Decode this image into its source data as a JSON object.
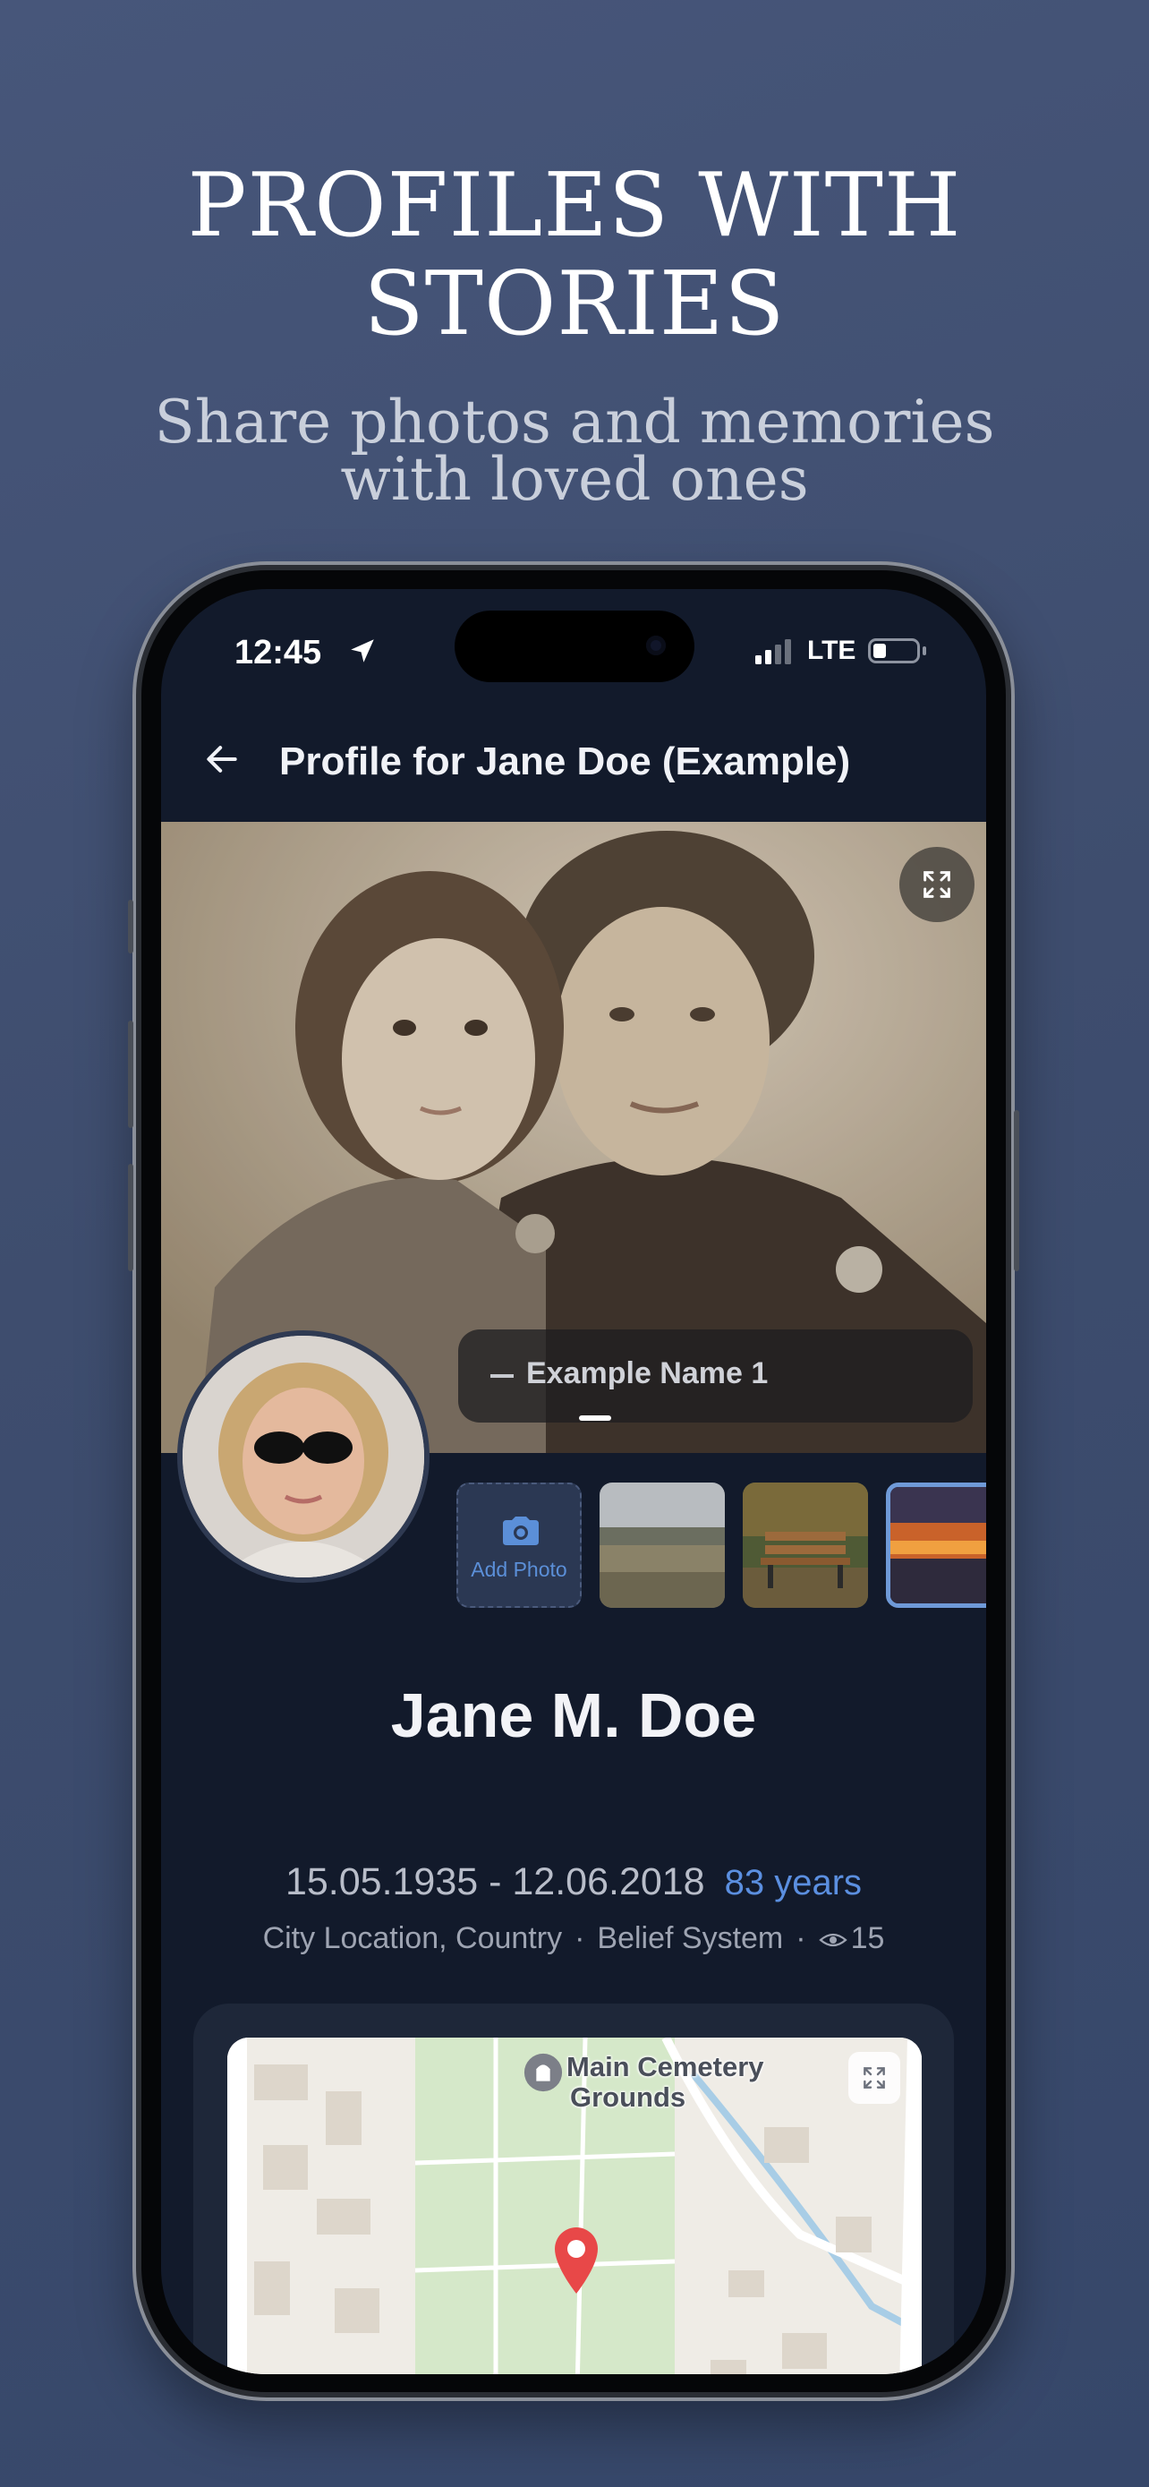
{
  "promo": {
    "title": "PROFILES WITH STORIES",
    "title_line1": "PROFILES WITH",
    "title_line2": "STORIES",
    "subtitle_line1": "Share photos and memories",
    "subtitle_line2": "with loved ones"
  },
  "status_bar": {
    "time": "12:45",
    "network": "LTE"
  },
  "header": {
    "back_icon": "arrow-left-icon",
    "title": "Profile for Jane Doe (Example)"
  },
  "hero": {
    "caption": "Example Name 1",
    "expand_icon": "expand-icon",
    "slide_count_visible": 1
  },
  "gallery": {
    "add_photo_label": "Add Photo",
    "camera_icon": "camera-icon",
    "thumbnails": [
      "landscape-photo",
      "park-bench-photo",
      "sunset-photo"
    ]
  },
  "profile": {
    "name": "Jane M. Doe",
    "dates": "15.05.1935 - 12.06.2018",
    "age": "83 years",
    "location": "City Location, Country",
    "belief": "Belief System",
    "views": "15"
  },
  "map": {
    "poi_label_line1": "Main Cemetery",
    "poi_label_line2": "Grounds",
    "expand_icon": "expand-icon",
    "pin_icon": "location-pin-icon"
  },
  "colors": {
    "background": "#3e4d6e",
    "screen": "#121a2b",
    "accent": "#5b8fe0",
    "pin": "#e84848"
  }
}
